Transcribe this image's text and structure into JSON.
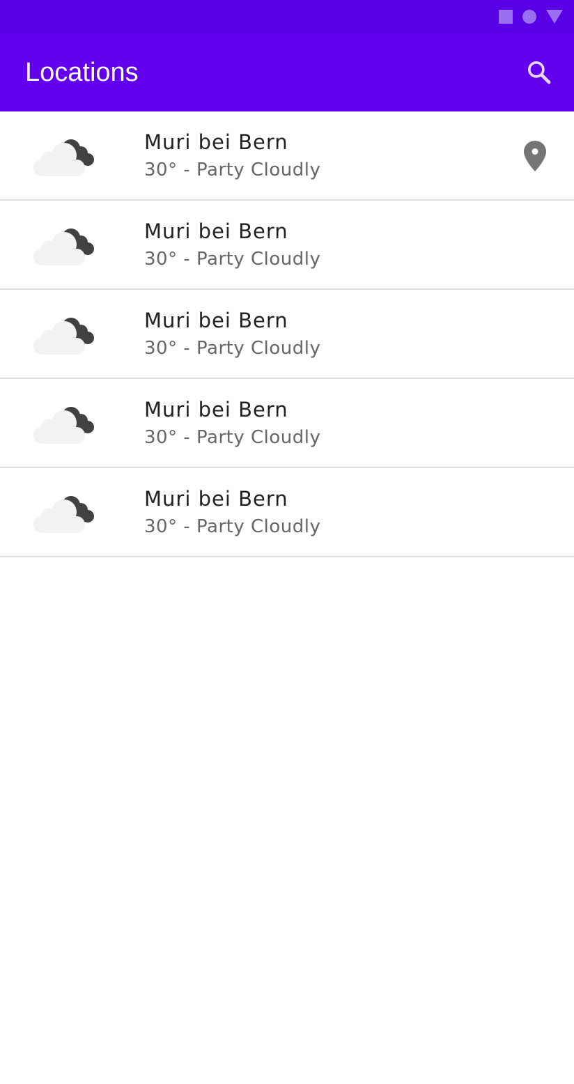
{
  "app_bar": {
    "title": "Locations"
  },
  "colors": {
    "status_bar": "#5700e6",
    "app_bar": "#6200ee",
    "status_icons": "#9b6ff2",
    "divider": "#e0e0e0",
    "pin": "#757575"
  },
  "icons": {
    "status": [
      "square-icon",
      "circle-icon",
      "triangle-icon"
    ],
    "search": "search-icon",
    "weather": "partly-cloudy-icon",
    "location": "location-pin-icon"
  },
  "locations": [
    {
      "name": "Muri bei Bern",
      "summary": "30° - Party Cloudly",
      "current_location": true
    },
    {
      "name": "Muri bei Bern",
      "summary": "30° - Party Cloudly",
      "current_location": false
    },
    {
      "name": "Muri bei Bern",
      "summary": "30° - Party Cloudly",
      "current_location": false
    },
    {
      "name": "Muri bei Bern",
      "summary": "30° - Party Cloudly",
      "current_location": false
    },
    {
      "name": "Muri bei Bern",
      "summary": "30° - Party Cloudly",
      "current_location": false
    }
  ]
}
